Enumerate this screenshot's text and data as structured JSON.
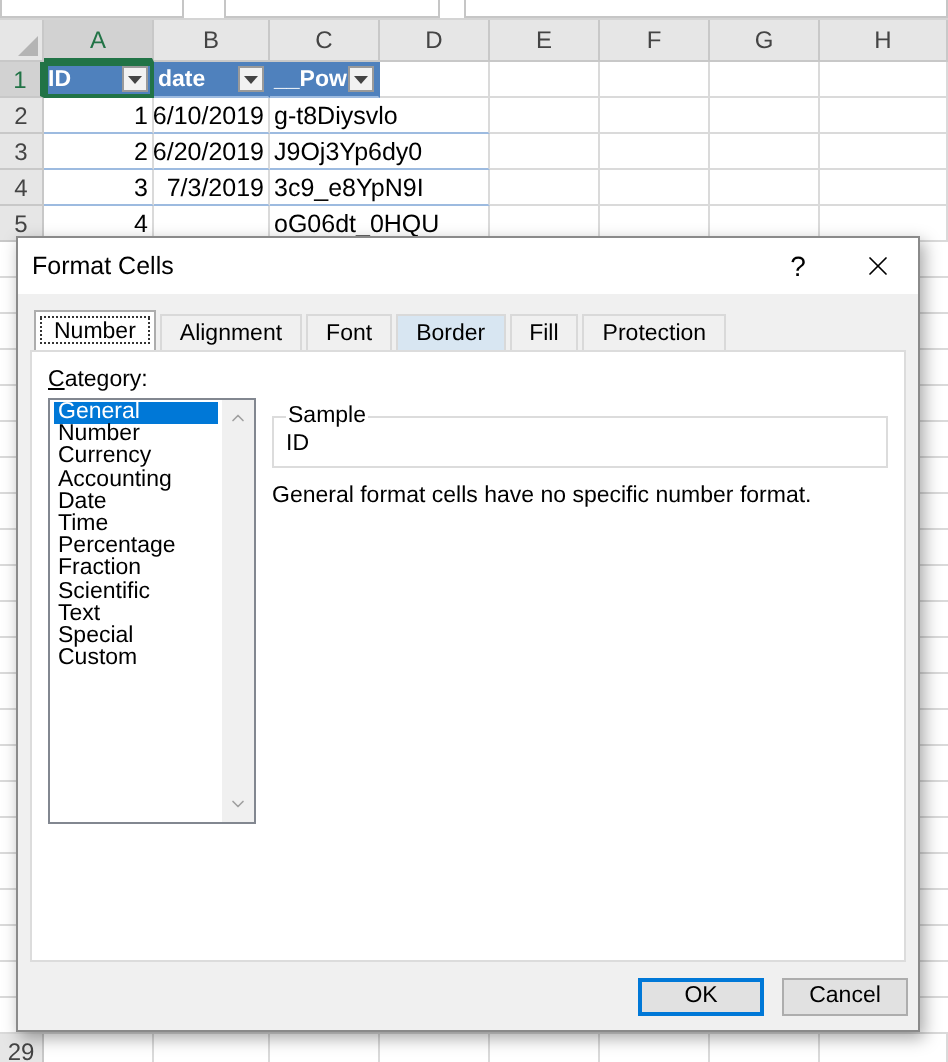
{
  "spreadsheet": {
    "columns": [
      {
        "label": "A",
        "selected": true
      },
      {
        "label": "B",
        "selected": false
      },
      {
        "label": "C",
        "selected": false
      },
      {
        "label": "D",
        "selected": false
      },
      {
        "label": "E",
        "selected": false
      },
      {
        "label": "F",
        "selected": false
      },
      {
        "label": "G",
        "selected": false
      },
      {
        "label": "H",
        "selected": false
      }
    ],
    "rows": [
      {
        "number": "1",
        "selected": true,
        "cells": [
          {
            "kind": "header",
            "text": "ID",
            "active": true
          },
          {
            "kind": "header",
            "text": "date",
            "active": false
          },
          {
            "kind": "header",
            "text": "__Pow",
            "active": false
          }
        ]
      },
      {
        "number": "2",
        "selected": false,
        "cells": [
          {
            "kind": "number",
            "text": "1",
            "active": false
          },
          {
            "kind": "number",
            "text": "6/10/2019",
            "active": false
          },
          {
            "kind": "text",
            "text": "g-t8Diysvlo",
            "active": false
          }
        ]
      },
      {
        "number": "3",
        "selected": false,
        "cells": [
          {
            "kind": "number",
            "text": "2",
            "active": false
          },
          {
            "kind": "number",
            "text": "6/20/2019",
            "active": false
          },
          {
            "kind": "text",
            "text": "J9Oj3Yp6dy0",
            "active": false
          }
        ]
      },
      {
        "number": "4",
        "selected": false,
        "cells": [
          {
            "kind": "number",
            "text": "3",
            "active": false
          },
          {
            "kind": "number",
            "text": "7/3/2019",
            "active": false
          },
          {
            "kind": "text",
            "text": "3c9_e8YpN9I",
            "active": false
          }
        ]
      },
      {
        "number": "5",
        "selected": false,
        "cells": [
          {
            "kind": "number",
            "text": "4",
            "active": false
          },
          {
            "kind": "blank",
            "active": false
          },
          {
            "kind": "text",
            "text": "oG06dt_0HQU",
            "active": false
          }
        ]
      }
    ],
    "bottom_row": {
      "number": "29"
    }
  },
  "dialog": {
    "title": "Format Cells",
    "help": "?",
    "tabs": [
      {
        "label": "Number",
        "selected": true,
        "hovered": false
      },
      {
        "label": "Alignment",
        "selected": false,
        "hovered": false
      },
      {
        "label": "Font",
        "selected": false,
        "hovered": false
      },
      {
        "label": "Border",
        "selected": false,
        "hovered": true
      },
      {
        "label": "Fill",
        "selected": false,
        "hovered": false
      },
      {
        "label": "Protection",
        "selected": false,
        "hovered": false
      }
    ],
    "category_label": "Category:",
    "categories": [
      {
        "label": "General",
        "selected": true
      },
      {
        "label": "Number",
        "selected": false
      },
      {
        "label": "Currency",
        "selected": false
      },
      {
        "label": "Accounting",
        "selected": false
      },
      {
        "label": "Date",
        "selected": false
      },
      {
        "label": "Time",
        "selected": false
      },
      {
        "label": "Percentage",
        "selected": false
      },
      {
        "label": "Fraction",
        "selected": false
      },
      {
        "label": "Scientific",
        "selected": false
      },
      {
        "label": "Text",
        "selected": false
      },
      {
        "label": "Special",
        "selected": false
      },
      {
        "label": "Custom",
        "selected": false
      }
    ],
    "sample": {
      "legend": "Sample",
      "value": "ID"
    },
    "description": "General format cells have no specific number format.",
    "buttons": [
      {
        "label": "OK",
        "default": true
      },
      {
        "label": "Cancel",
        "default": false
      }
    ]
  }
}
